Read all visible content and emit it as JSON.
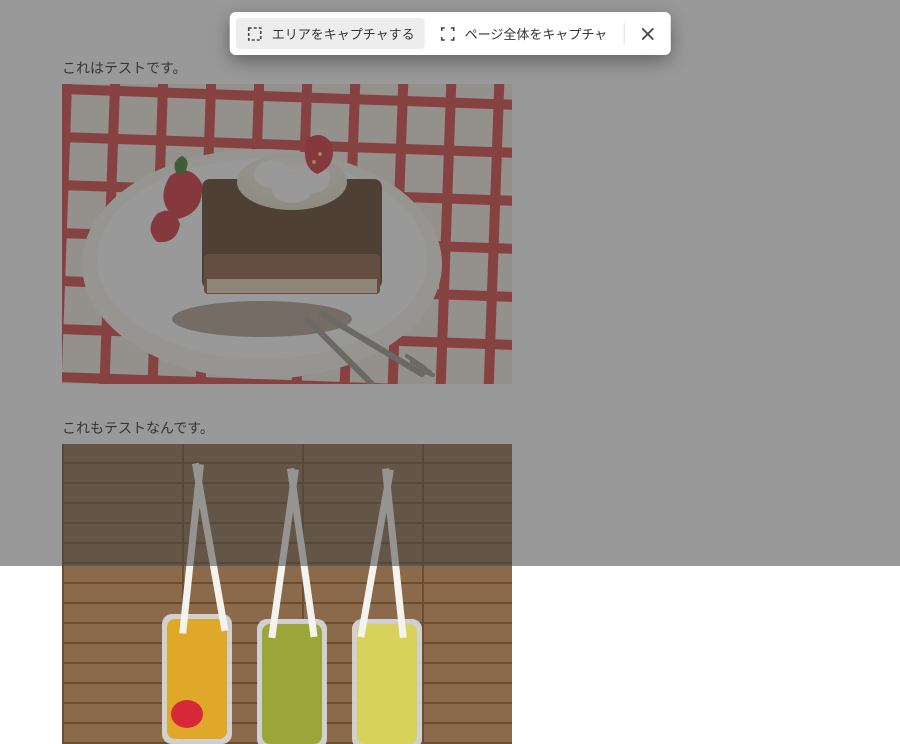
{
  "content": {
    "sections": [
      {
        "caption": "これはテストです。"
      },
      {
        "caption": "これもテストなんです。"
      }
    ]
  },
  "toolbar": {
    "capture_area_label": "エリアをキャプチャする",
    "capture_fullpage_label": "ページ全体をキャプチャ"
  }
}
